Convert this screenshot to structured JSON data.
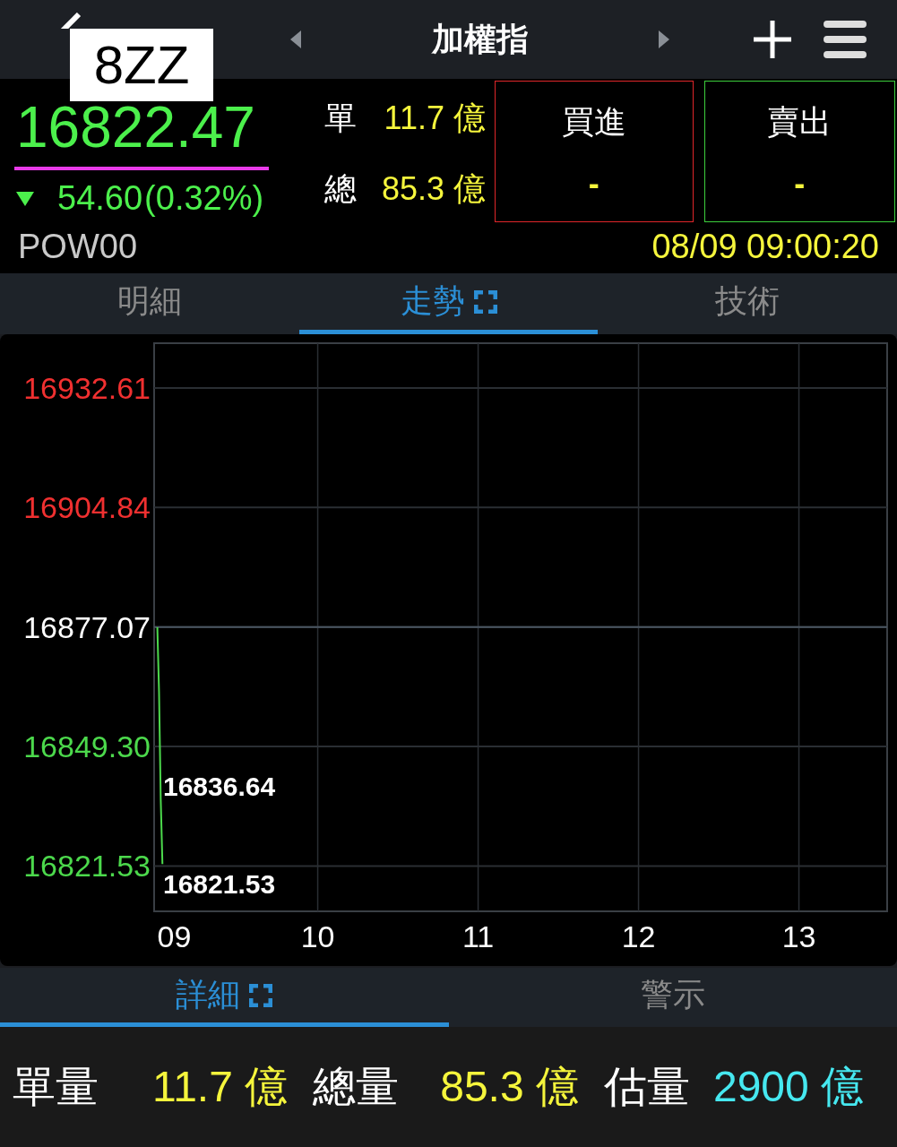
{
  "header": {
    "title": "加權指",
    "overlay_label": "8ZZ"
  },
  "quote": {
    "price": "16822.47",
    "change": "54.60",
    "change_pct": "(0.32%)",
    "symbol": "POW00",
    "time": "08/09 09:00:20",
    "stats": [
      {
        "label": "單",
        "value": "11.7",
        "unit": "億"
      },
      {
        "label": "總",
        "value": "85.3",
        "unit": "億"
      }
    ],
    "orders": [
      {
        "label": "買進",
        "value": "-",
        "color": "#e0262a"
      },
      {
        "label": "賣出",
        "value": "-",
        "color": "#3ccf3c"
      }
    ]
  },
  "tabs": [
    {
      "label": "明細",
      "selected": false,
      "expandable": false
    },
    {
      "label": "走勢",
      "selected": true,
      "expandable": true
    },
    {
      "label": "技術",
      "selected": false,
      "expandable": false
    }
  ],
  "chart": {
    "chart_data": {
      "type": "line",
      "x": [
        9.0,
        9.005,
        9.01,
        9.015
      ],
      "series": [
        {
          "color": "#4cd94c",
          "values": [
            16877,
            16862,
            16837,
            16822
          ]
        }
      ],
      "xlim": [
        8.98,
        13.55
      ],
      "ylim": [
        16811,
        16943
      ],
      "xticks": [
        {
          "value": 9,
          "label": "09"
        },
        {
          "value": 10,
          "label": "10"
        },
        {
          "value": 11,
          "label": "11"
        },
        {
          "value": 12,
          "label": "12"
        },
        {
          "value": 13,
          "label": "13"
        }
      ],
      "yticks": [
        {
          "value": 16932.61,
          "label": "16932.61"
        },
        {
          "value": 16904.84,
          "label": "16904.84"
        },
        {
          "value": 16877.07,
          "label": "16877.07"
        },
        {
          "value": 16849.3,
          "label": "16849.30"
        },
        {
          "value": 16821.53,
          "label": "16821.53"
        }
      ],
      "ref_lines": [
        {
          "axis": "y",
          "value": 16877.07
        }
      ],
      "grid": true,
      "annotations": [
        {
          "text": "16836.64"
        },
        {
          "text": "16821.53"
        }
      ]
    }
  },
  "bottom_tabs": [
    {
      "label": "詳細",
      "selected": true,
      "expandable": true
    },
    {
      "label": "警示",
      "selected": false,
      "expandable": false
    }
  ],
  "summary": [
    {
      "label": "單量",
      "value": "11.7",
      "unit": "億",
      "color": "#f5f53c"
    },
    {
      "label": "總量",
      "value": "85.3",
      "unit": "億",
      "color": "#f5f53c"
    },
    {
      "label": "估量",
      "value": "2900",
      "unit": "億",
      "color": "#46e8f0"
    }
  ]
}
